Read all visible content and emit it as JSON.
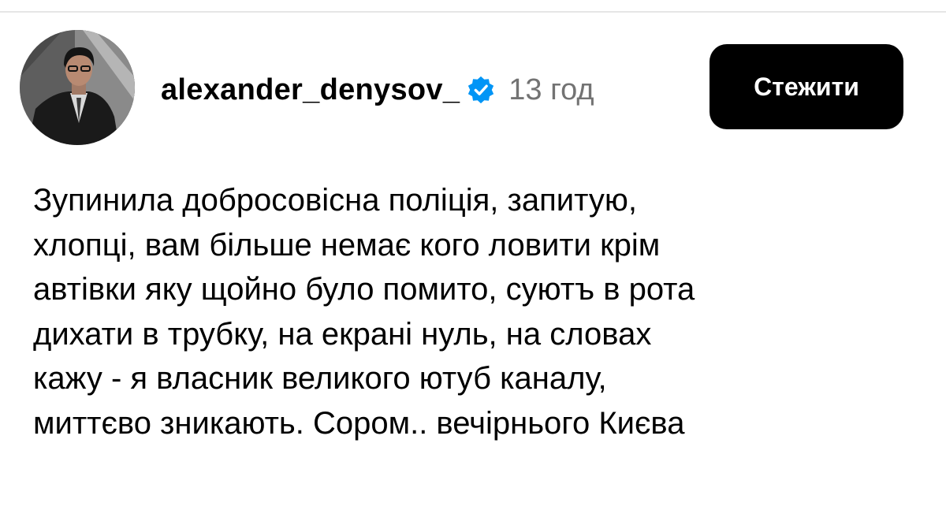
{
  "post": {
    "username": "alexander_denysov_",
    "time": "13 год",
    "follow_label": "Стежити",
    "text_lines": [
      "Зупинила добросовісна поліція, запитую,",
      "хлопці, вам більше немає кого ловити крім",
      "автівки яку щойно було помито, суютъ в рота",
      "дихати в трубку, на екрані нуль, на словах",
      "кажу -  я власник великого  ютуб каналу,",
      "миттєво зникають. Сором.. вечірнього Києва"
    ]
  },
  "icons": {
    "verified": "verified-badge-icon",
    "avatar": "profile-photo"
  },
  "colors": {
    "verified": "#0095f6",
    "button_bg": "#000000",
    "time_text": "#737373"
  }
}
